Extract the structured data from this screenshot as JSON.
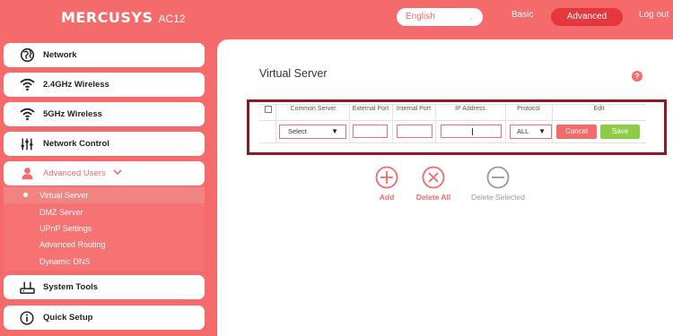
{
  "header": {
    "brand": "MERCUSYS",
    "model": "AC12",
    "language": "English",
    "nav_basic": "Basic",
    "nav_advanced": "Advanced",
    "nav_logout": "Log out"
  },
  "sidebar": {
    "items": [
      {
        "label": "Network",
        "icon": "globe-icon"
      },
      {
        "label": "2.4GHz Wireless",
        "icon": "wifi-icon"
      },
      {
        "label": "5GHz Wireless",
        "icon": "wifi-icon"
      },
      {
        "label": "Network Control",
        "icon": "sliders-icon"
      },
      {
        "label": "Advanced Users",
        "icon": "user-icon"
      },
      {
        "label": "System Tools",
        "icon": "tools-icon"
      },
      {
        "label": "Quick Setup",
        "icon": "info-icon"
      }
    ],
    "subitems": [
      "Virtual Server",
      "DMZ Server",
      "UPnP Settings",
      "Advanced Routing",
      "Dynamic DNS"
    ]
  },
  "main": {
    "title": "Virtual Server",
    "table": {
      "headers": [
        "Common Server",
        "External Port",
        "Internal Port",
        "IP Address",
        "Protocol",
        "Edit"
      ],
      "select_value": "Select",
      "protocol_value": "ALL",
      "cancel_label": "Cancel",
      "save_label": "Save"
    },
    "actions": {
      "add": "Add",
      "delete_all": "Delete All",
      "delete_selected": "Delete Selected"
    }
  },
  "colors": {
    "brand": "#f56a6a",
    "advanced_active": "#e5373d",
    "save_green": "#8dcc45",
    "highlight_border": "#8b1a24"
  }
}
